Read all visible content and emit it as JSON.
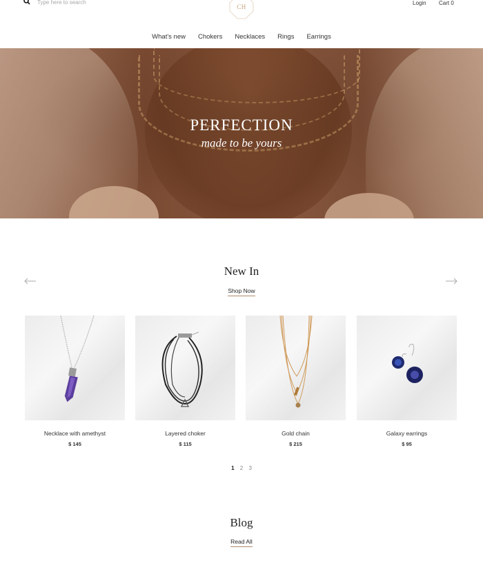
{
  "header": {
    "search_placeholder": "Type here to search",
    "logo_text": "CH",
    "login_label": "Login",
    "cart_label": "Cart 0"
  },
  "nav": {
    "items": [
      {
        "label": "What's new"
      },
      {
        "label": "Chokers"
      },
      {
        "label": "Necklaces"
      },
      {
        "label": "Rings"
      },
      {
        "label": "Earrings"
      }
    ]
  },
  "hero": {
    "title": "PERFECTION",
    "subtitle": "made to be yours"
  },
  "new_in": {
    "title": "New In",
    "link_label": "Shop Now",
    "products": [
      {
        "name": "Necklace with amethyst",
        "price": "$ 145",
        "image_icon": "amethyst-necklace-icon"
      },
      {
        "name": "Layered choker",
        "price": "$ 115",
        "image_icon": "choker-icon"
      },
      {
        "name": "Gold chain",
        "price": "$ 215",
        "image_icon": "gold-chain-icon"
      },
      {
        "name": "Galaxy earrings",
        "price": "$ 95",
        "image_icon": "earrings-icon"
      }
    ],
    "pages": [
      "1",
      "2",
      "3"
    ],
    "current_page": "1"
  },
  "blog": {
    "title": "Blog",
    "link_label": "Read All"
  },
  "colors": {
    "accent": "#b08968",
    "logo": "#c7a27c",
    "hero_bg": "#7a4a32"
  }
}
